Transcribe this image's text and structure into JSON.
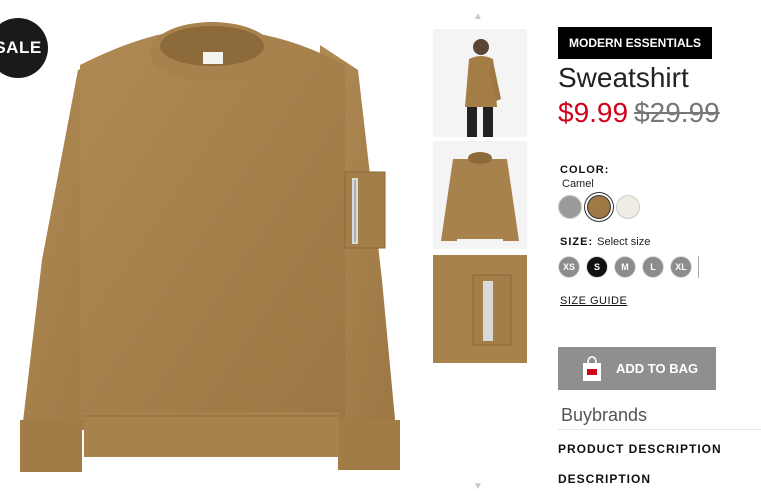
{
  "badge": {
    "sale": "SALE"
  },
  "product": {
    "collection": "MODERN ESSENTIALS",
    "title": "Sweatshirt",
    "price_sale": "$9.99",
    "price_original": "$29.99"
  },
  "color": {
    "label": "COLOR:",
    "selected": "Camel",
    "swatches": [
      "#9a9a9a",
      "#a07a45",
      "#eeece4"
    ]
  },
  "size": {
    "label": "SIZE:",
    "hint": "Select size",
    "options": [
      "XS",
      "S",
      "M",
      "L",
      "XL"
    ],
    "selected": "S"
  },
  "size_guide": "SIZE GUIDE",
  "add_to_bag": "ADD TO BAG",
  "brands": "Buybrands",
  "sections": {
    "product_description": "PRODUCT DESCRIPTION",
    "description": "DESCRIPTION"
  },
  "icons": {
    "thumb_up": "chevron-up-icon",
    "thumb_down": "chevron-down-icon",
    "bag": "shopping-bag-icon"
  }
}
